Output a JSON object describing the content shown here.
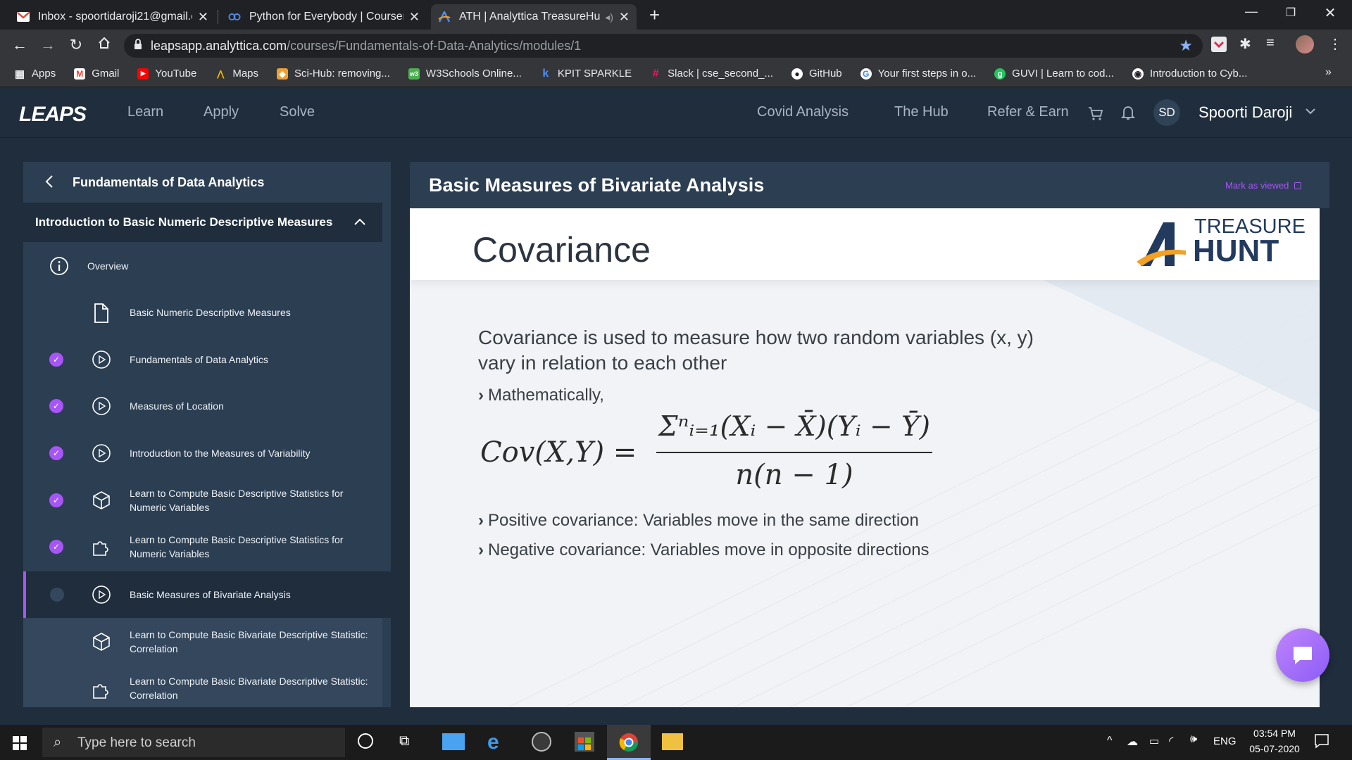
{
  "browser": {
    "tabs": [
      {
        "title": "Inbox - spoortidaroji21@gmail.com",
        "icon": "gmail-icon"
      },
      {
        "title": "Python for Everybody | Coursera",
        "icon": "coursera-icon"
      },
      {
        "title": "ATH | Analyttica TreasureHunt",
        "icon": "treasurehunt-icon",
        "active": true
      }
    ],
    "new_tab": "+",
    "url_host": "leapsapp.analyttica.com",
    "url_path": "/courses/Fundamentals-of-Data-Analytics/modules/1",
    "bookmarks": [
      {
        "label": "Apps",
        "icon": "apps-grid-icon"
      },
      {
        "label": "Gmail",
        "icon": "gmail-icon"
      },
      {
        "label": "YouTube",
        "icon": "youtube-icon"
      },
      {
        "label": "Maps",
        "icon": "maps-icon"
      },
      {
        "label": "Sci-Hub: removing...",
        "icon": "scihub-icon"
      },
      {
        "label": "W3Schools Online...",
        "icon": "w3schools-icon"
      },
      {
        "label": "KPIT SPARKLE",
        "icon": "kpit-icon"
      },
      {
        "label": "Slack | cse_second_...",
        "icon": "slack-icon"
      },
      {
        "label": "GitHub",
        "icon": "github-icon"
      },
      {
        "label": "Your first steps in o...",
        "icon": "google-icon"
      },
      {
        "label": "GUVI | Learn to cod...",
        "icon": "guvi-icon"
      },
      {
        "label": "Introduction to Cyb...",
        "icon": "globe-icon"
      }
    ],
    "bookmarks_more": "»"
  },
  "app": {
    "logo": "LEAPS",
    "nav_left": [
      "Learn",
      "Apply",
      "Solve"
    ],
    "nav_right": [
      "Covid Analysis",
      "The Hub",
      "Refer & Earn"
    ],
    "user_initials": "SD",
    "user_name": "Spoorti Daroji"
  },
  "sidebar": {
    "course_title": "Fundamentals of Data Analytics",
    "section_title": "Introduction to Basic Numeric Descriptive Measures",
    "items": [
      {
        "label": "Overview",
        "icon": "info-icon",
        "checked": false
      },
      {
        "label": "Basic Numeric Descriptive Measures",
        "icon": "document-icon",
        "checked": false
      },
      {
        "label": "Fundamentals of Data Analytics",
        "icon": "play-icon",
        "checked": true
      },
      {
        "label": "Measures of Location",
        "icon": "play-icon",
        "checked": true
      },
      {
        "label": "Introduction to the Measures of Variability",
        "icon": "play-icon",
        "checked": true
      },
      {
        "label": "Learn to Compute Basic Descriptive Statistics for Numeric Variables",
        "icon": "cube-icon",
        "checked": true
      },
      {
        "label": "Learn to Compute Basic Descriptive Statistics for Numeric Variables",
        "icon": "puzzle-icon",
        "checked": true
      },
      {
        "label": "Basic Measures of Bivariate Analysis",
        "icon": "play-icon",
        "checked": false,
        "active": true
      },
      {
        "label": "Learn to Compute Basic Bivariate Descriptive Statistic: Correlation",
        "icon": "cube-icon",
        "checked": false
      },
      {
        "label": "Learn to Compute Basic Bivariate Descriptive Statistic: Correlation",
        "icon": "puzzle-icon",
        "checked": false
      }
    ]
  },
  "main": {
    "title": "Basic Measures of Bivariate Analysis",
    "mark_as_viewed": "Mark as viewed",
    "slide": {
      "heading": "Covariance",
      "brand_top": "TREASURE",
      "brand_bottom": "HUNT",
      "intro_line1": "Covariance is used to measure how two random variables (x, y)",
      "intro_line2": "vary in relation to each other",
      "math_label": "Mathematically,",
      "formula_lhs": "Cov(X,Y) =",
      "formula_num": "Σⁿᵢ₌₁(Xᵢ − X̄)(Yᵢ − Ȳ)",
      "formula_den": "n(n − 1)",
      "bullet_positive": "Positive covariance: Variables move in the same direction",
      "bullet_negative": "Negative covariance: Variables move in opposite directions"
    }
  },
  "taskbar": {
    "search_placeholder": "Type here to search",
    "language": "ENG",
    "time": "03:54 PM",
    "date": "05-07-2020"
  },
  "colors": {
    "accent_purple": "#a855f7",
    "app_bg": "#1f2d3d",
    "panel_bg": "#2c3e52",
    "brand_orange": "#f4a023",
    "brand_navy": "#223a5e"
  }
}
